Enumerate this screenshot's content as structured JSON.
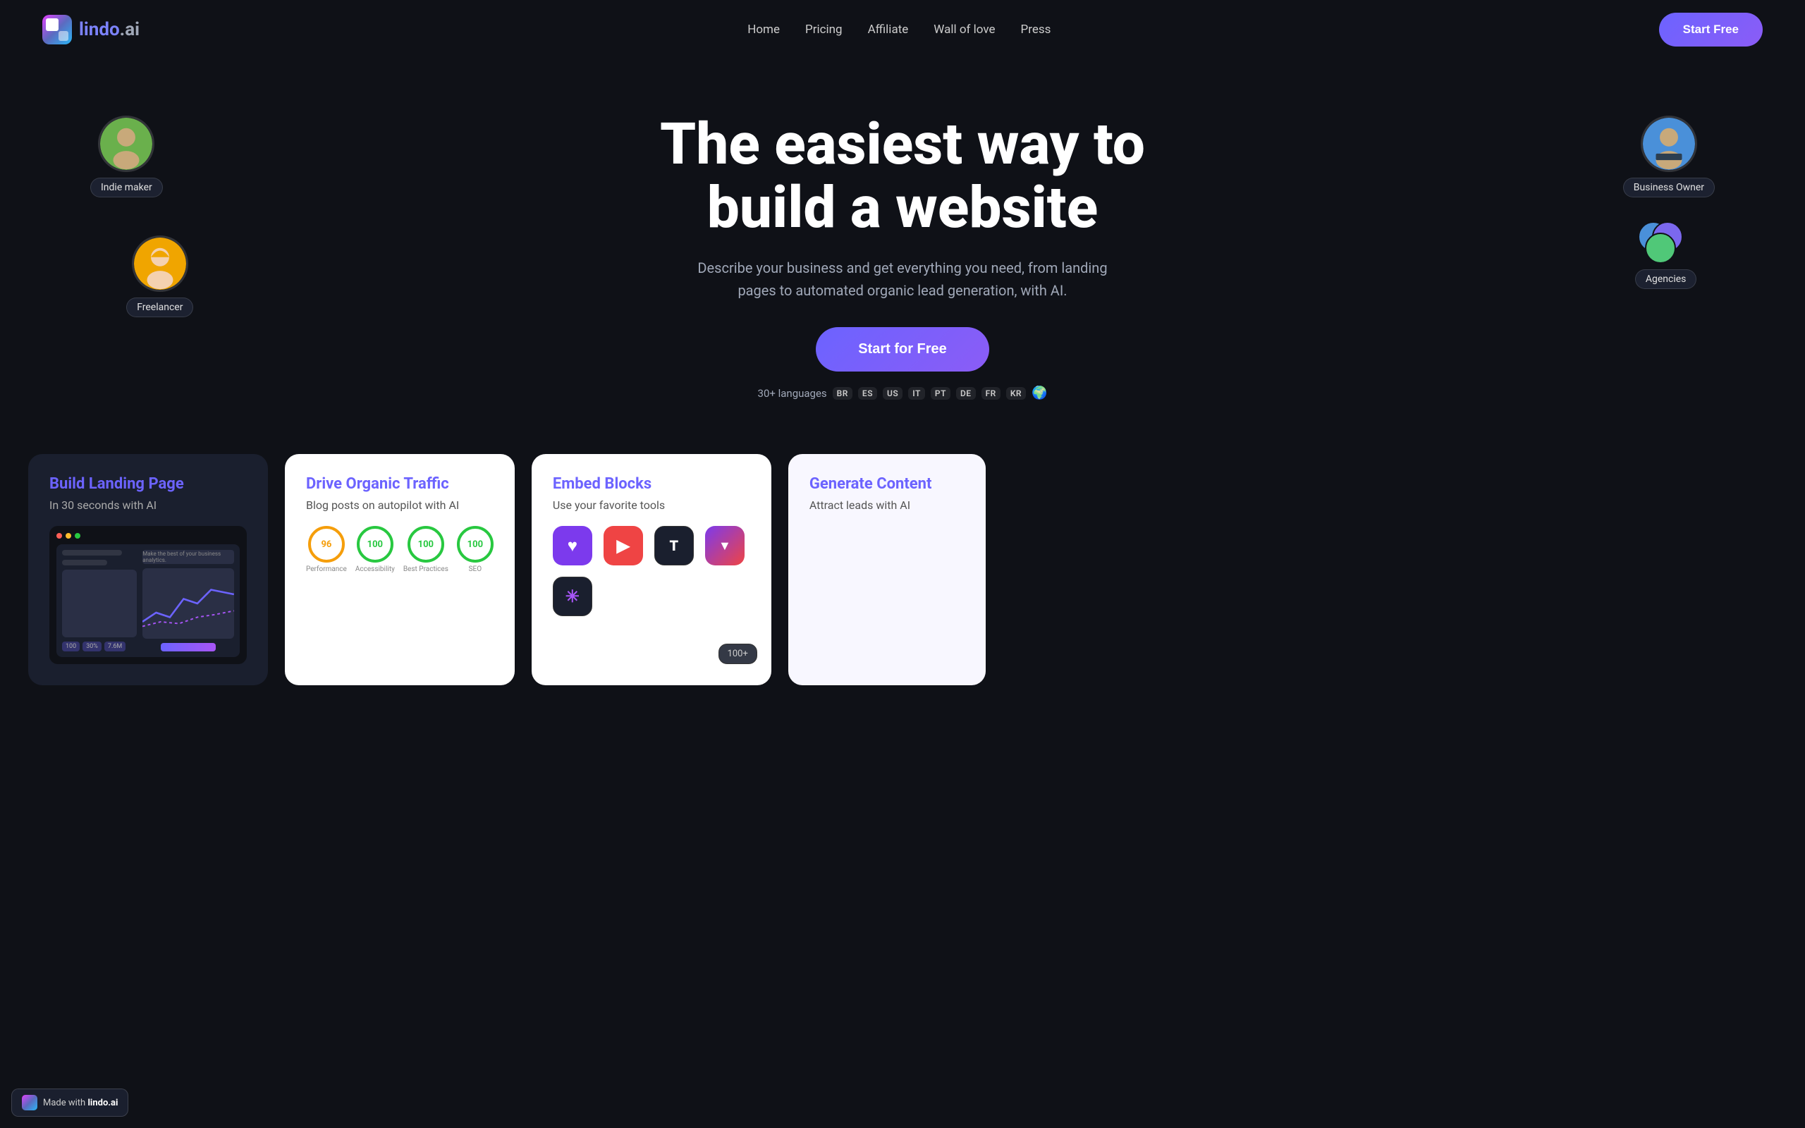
{
  "nav": {
    "logo_text_bold": "lindo",
    "logo_text_light": ".ai",
    "links": [
      {
        "label": "Home",
        "id": "home"
      },
      {
        "label": "Pricing",
        "id": "pricing"
      },
      {
        "label": "Affiliate",
        "id": "affiliate"
      },
      {
        "label": "Wall of love",
        "id": "wall-of-love"
      },
      {
        "label": "Press",
        "id": "press"
      }
    ],
    "cta_label": "Start Free"
  },
  "hero": {
    "title_line1": "The easiest way to",
    "title_line2": "build a website",
    "subtitle": "Describe your business and get everything you need, from landing pages to automated organic lead generation, with AI.",
    "cta_label": "Start for Free",
    "languages_prefix": "30+ languages",
    "languages": [
      "BR",
      "ES",
      "US",
      "IT",
      "PT",
      "DE",
      "FR",
      "KR"
    ]
  },
  "avatars": [
    {
      "id": "indie-maker",
      "label": "Indie maker",
      "position": "top-left",
      "color": "#6ab04c"
    },
    {
      "id": "freelancer",
      "label": "Freelancer",
      "position": "middle-left",
      "color": "#f0a500"
    },
    {
      "id": "business-owner",
      "label": "Business Owner",
      "position": "top-right",
      "color": "#4a90d9"
    },
    {
      "id": "agencies",
      "label": "Agencies",
      "position": "middle-right"
    }
  ],
  "features": [
    {
      "id": "build-landing-page",
      "title": "Build Landing Page",
      "subtitle": "In 30 seconds with AI",
      "type": "dark"
    },
    {
      "id": "drive-organic-traffic",
      "title": "Drive Organic Traffic",
      "subtitle": "Blog posts on autopilot with AI",
      "type": "light",
      "seo_scores": [
        {
          "score": "96",
          "label": "Performance"
        },
        {
          "score": "100",
          "label": "Accessibility"
        },
        {
          "score": "100",
          "label": "Best Practices"
        },
        {
          "score": "100",
          "label": "SEO"
        }
      ]
    },
    {
      "id": "embed-blocks",
      "title": "Embed Blocks",
      "subtitle": "Use your favorite tools",
      "type": "light"
    },
    {
      "id": "generate-content",
      "title": "Generate Content",
      "subtitle": "Attract leads with AI",
      "type": "light"
    }
  ],
  "made_with": {
    "prefix": "Made with",
    "brand": "lindo.ai"
  }
}
